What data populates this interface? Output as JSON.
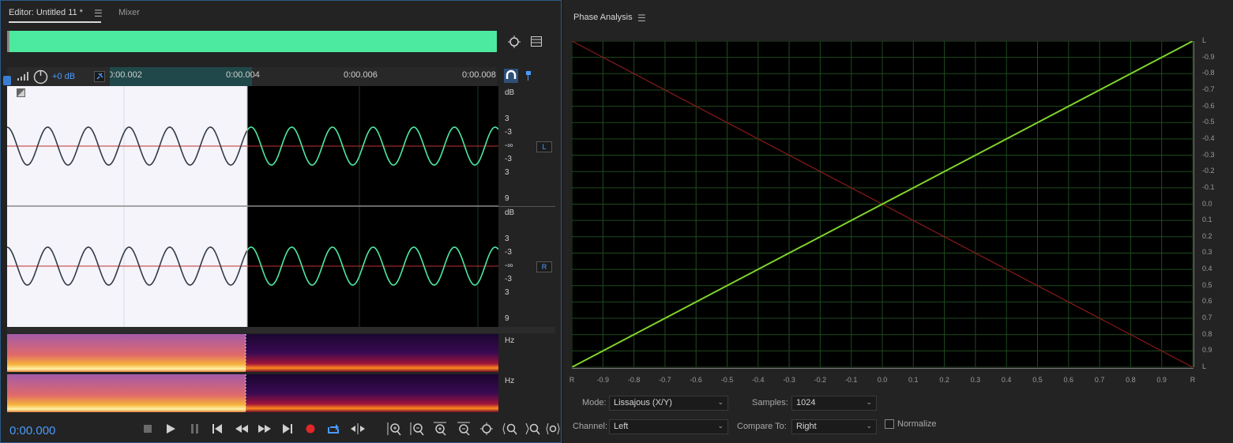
{
  "editor": {
    "tab_title": "Editor: Untitled 11 *",
    "tab_mixer": "Mixer",
    "menu_icon": "☰",
    "volume": "+0 dB",
    "ruler_labels": [
      "0:00.002",
      "0:00.004",
      "0:00.006",
      "0:00.008"
    ],
    "db_label": "dB",
    "scale_top": [
      "3",
      "-3",
      "-∞",
      "-3",
      "3",
      "9"
    ],
    "channels": [
      "L",
      "R"
    ],
    "hz_label": "Hz",
    "time": "0:00.000"
  },
  "phase": {
    "title": "Phase Analysis",
    "menu_icon": "☰",
    "x_ticks": [
      "R",
      "-0.9",
      "-0.8",
      "-0.7",
      "-0.6",
      "-0.5",
      "-0.4",
      "-0.3",
      "-0.2",
      "-0.1",
      "0.0",
      "0.1",
      "0.2",
      "0.3",
      "0.4",
      "0.5",
      "0.6",
      "0.7",
      "0.8",
      "0.9",
      "R"
    ],
    "y_ticks": [
      "L",
      "-0.9",
      "-0.8",
      "-0.7",
      "-0.6",
      "-0.5",
      "-0.4",
      "-0.3",
      "-0.2",
      "-0.1",
      "0.0",
      "0.1",
      "0.2",
      "0.3",
      "0.4",
      "0.5",
      "0.6",
      "0.7",
      "0.8",
      "0.9",
      "L"
    ],
    "mode_label": "Mode:",
    "mode_value": "Lissajous (X/Y)",
    "samples_label": "Samples:",
    "samples_value": "1024",
    "channel_label": "Channel:",
    "channel_value": "Left",
    "compare_label": "Compare To:",
    "compare_value": "Right",
    "normalize_label": "Normalize"
  },
  "colors": {
    "accent": "#4a9bff",
    "waveform": "#4ce9a0",
    "phase_line": "#7fd32b",
    "reference_line": "#8a1a1a"
  }
}
